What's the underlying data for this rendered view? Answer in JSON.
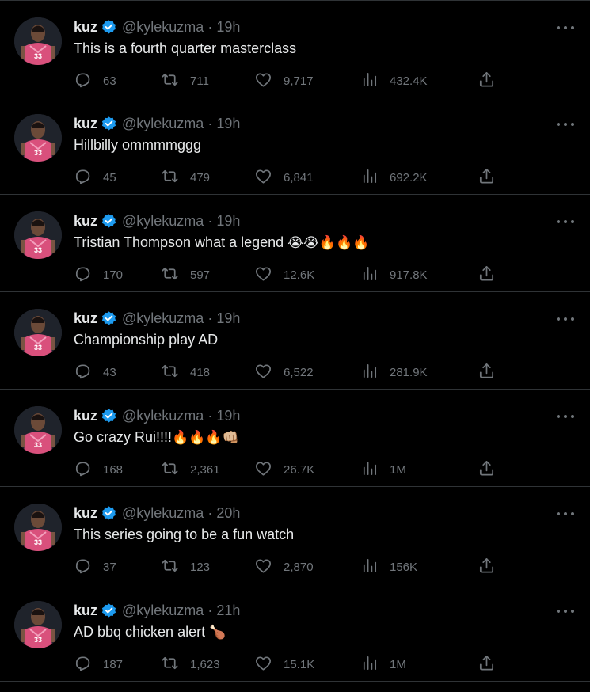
{
  "colors": {
    "background": "#000000",
    "text": "#e7e9ea",
    "muted": "#71767b",
    "divider": "#2f3336",
    "verified": "#1d9bf0"
  },
  "icons": {
    "reply": "speech-bubble-icon",
    "retweet": "retweet-arrows-icon",
    "like": "heart-icon",
    "views": "bar-chart-icon",
    "share": "share-upload-icon",
    "more": "more-dots-icon",
    "verified": "verified-badge-icon"
  },
  "tweets": [
    {
      "name": "kuz",
      "handle": "@kylekuzma",
      "time": "19h",
      "text": "This is a fourth quarter masterclass",
      "emoji": "",
      "replies": "63",
      "retweets": "711",
      "likes": "9,717",
      "views": "432.4K"
    },
    {
      "name": "kuz",
      "handle": "@kylekuzma",
      "time": "19h",
      "text": "Hillbilly ommmmggg",
      "emoji": "",
      "replies": "45",
      "retweets": "479",
      "likes": "6,841",
      "views": "692.2K"
    },
    {
      "name": "kuz",
      "handle": "@kylekuzma",
      "time": "19h",
      "text": "Tristian Thompson what a legend ",
      "emoji": "😭😭🔥🔥🔥",
      "replies": "170",
      "retweets": "597",
      "likes": "12.6K",
      "views": "917.8K"
    },
    {
      "name": "kuz",
      "handle": "@kylekuzma",
      "time": "19h",
      "text": "Championship play AD",
      "emoji": "",
      "replies": "43",
      "retweets": "418",
      "likes": "6,522",
      "views": "281.9K"
    },
    {
      "name": "kuz",
      "handle": "@kylekuzma",
      "time": "19h",
      "text": "Go crazy Rui!!!!",
      "emoji": "🔥🔥🔥👊🏼",
      "replies": "168",
      "retweets": "2,361",
      "likes": "26.7K",
      "views": "1M"
    },
    {
      "name": "kuz",
      "handle": "@kylekuzma",
      "time": "20h",
      "text": "This series going to be a fun watch",
      "emoji": "",
      "replies": "37",
      "retweets": "123",
      "likes": "2,870",
      "views": "156K"
    },
    {
      "name": "kuz",
      "handle": "@kylekuzma",
      "time": "21h",
      "text": "AD bbq chicken alert ",
      "emoji": "🍗",
      "replies": "187",
      "retweets": "1,623",
      "likes": "15.1K",
      "views": "1M"
    }
  ]
}
